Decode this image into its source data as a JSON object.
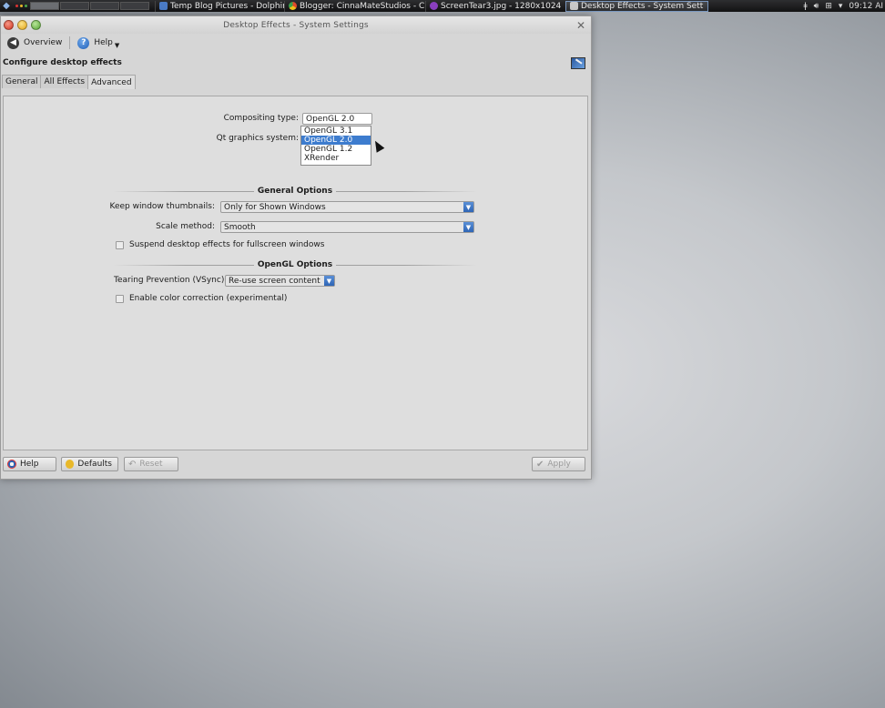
{
  "taskbar": {
    "tasks": [
      {
        "label": "Temp Blog Pictures - Dolphin",
        "active": false,
        "icon_color": "#4a7bc6"
      },
      {
        "label": "Blogger: CinnaMateStudios - C",
        "active": false,
        "icon_color": "#e04a2a"
      },
      {
        "label": "ScreenTear3.jpg - 1280x1024",
        "active": false,
        "icon_color": "#8a3fc0"
      },
      {
        "label": "Desktop Effects - System Sett",
        "active": true,
        "icon_color": "#c8c8c8"
      }
    ],
    "clock": "09:12 AI"
  },
  "window": {
    "title": "Desktop Effects - System Settings",
    "nav": {
      "overview": "Overview",
      "help": "Help"
    },
    "heading": "Configure desktop effects",
    "tabs": [
      {
        "label": "General",
        "active": false
      },
      {
        "label": "All Effects",
        "active": false
      },
      {
        "label": "Advanced",
        "active": true
      }
    ],
    "compositing": {
      "label": "Compositing type:",
      "value": "OpenGL 2.0"
    },
    "qt_graphics": {
      "label": "Qt graphics system:"
    },
    "dropdown_options": [
      {
        "label": "OpenGL 3.1",
        "selected": false
      },
      {
        "label": "OpenGL 2.0",
        "selected": true
      },
      {
        "label": "OpenGL 1.2",
        "selected": false
      },
      {
        "label": "XRender",
        "selected": false
      }
    ],
    "general_options": {
      "title": "General Options",
      "thumbnails_label": "Keep window thumbnails:",
      "thumbnails_value": "Only for Shown Windows",
      "scale_label": "Scale method:",
      "scale_value": "Smooth",
      "suspend_label": "Suspend desktop effects for fullscreen windows"
    },
    "opengl_options": {
      "title": "OpenGL Options",
      "tearing_label": "Tearing Prevention (VSync)",
      "tearing_value": "Re-use screen content",
      "color_correction_label": "Enable color correction (experimental)"
    },
    "buttons": {
      "help": "Help",
      "defaults": "Defaults",
      "reset": "Reset",
      "apply": "Apply"
    }
  }
}
